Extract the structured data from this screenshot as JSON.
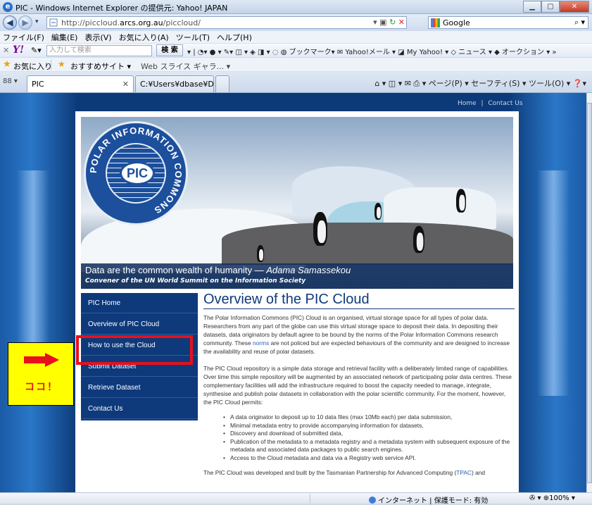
{
  "window": {
    "title": "PIC - Windows Internet Explorer の提供元: Yahoo! JAPAN",
    "buttons": {
      "min": "▁",
      "max": "▢",
      "close": "✕"
    }
  },
  "address": {
    "url_prefix": "http://piccloud.",
    "url_domain": "arcs.org.au",
    "url_suffix": "/piccloud/",
    "search_text": "Google"
  },
  "menu": [
    "ファイル(F)",
    "編集(E)",
    "表示(V)",
    "お気に入り(A)",
    "ツール(T)",
    "ヘルプ(H)"
  ],
  "toolbar": {
    "search_placeholder": "入力して検索",
    "search_button": "検 索",
    "rest": "▾ | ◔▾ ● ▾ ✎▾ ◫ ▾ ◈ ◨ ▾  ◌ ◍ ブックマーク▾ ✉ Yahoo!メール ▾ ◪ My Yahoo! ▾ ◇ ニュース ▾ ◆ オークション ▾ »"
  },
  "favorites": {
    "label": "お気に入り",
    "suggest": "おすすめサイト ▾",
    "webslice": "Web スライス ギャラ... ▾"
  },
  "tabs": {
    "quick": "88 ▾",
    "tab1": "PIC",
    "tab2": "C:¥Users¥dbase¥Deskt...",
    "command": "⌂ ▾  ◫ ▾  ✉  ⎙ ▾  ページ(P) ▾  セーフティ(S) ▾  ツール(O) ▾  ❓▾"
  },
  "site": {
    "toplinks": {
      "home": "Home",
      "sep": "|",
      "contact": "Contact Us"
    },
    "logo_text": "PIC",
    "logo_ring": "POLAR INFORMATION COMMONS",
    "caption_line1": "Data are the common wealth of humanity — ",
    "caption_author": "Adama Samassekou",
    "caption_line2": "Convener of the UN World Summit on the Information Society",
    "nav": [
      "PIC Home",
      "Overview of PIC Cloud",
      "How to use the Cloud",
      "Submit Dataset",
      "Retrieve Dataset",
      "Contact Us"
    ],
    "heading": "Overview of the PIC Cloud",
    "para1_a": "The Polar Information Commons (PIC) Cloud is an organised, virtual storage space for all types of polar data. Researchers from any part of the globe can use this virtual storage space to deposit their data. In depositing their datasets, data originators by default agree to be bound by the norms of the Polar Information Commons research community. These ",
    "para1_link": "norms",
    "para1_b": " are not policed but are expected behaviours of the community and are designed to increase the availability and reuse of polar datasets.",
    "para2": "The PIC Cloud repository is a simple data storage and retrieval facility with a deliberately limited range of capabilities. Over time this simple repository will be augmented by an associated network of participating polar data centres. These complementary facilities will add the infrastructure required to boost the capacity needed to manage, integrate, synthesise and publish polar datasets in collaboration with the polar scientific community. For the moment, however, the PIC Cloud permits:",
    "bullets": [
      "A data originator to deposit up to 10 data files (max 10Mb each) per data submission,",
      "Minimal metadata entry to provide accompanying information for datasets,",
      "Discovery and download of submitted data,",
      "Publication of the metadata to a metadata registry and a metadata system with subsequent exposure of the metadata and associated data packages to public search engines.",
      "Access to the Cloud metadata and data via a Registry web service API."
    ],
    "para3_a": "The PIC Cloud was developed and built by the Tasmanian Partnership for Advanced Computing (",
    "para3_link": "TPAC",
    "para3_b": ") and"
  },
  "callout": {
    "text": "ココ！",
    "color": "#ffff00",
    "accent": "#e8101c"
  },
  "status": {
    "zone": "インターネット | 保護モード: 有効",
    "zoom": "✇ ▾  ⊕100%  ▾"
  }
}
